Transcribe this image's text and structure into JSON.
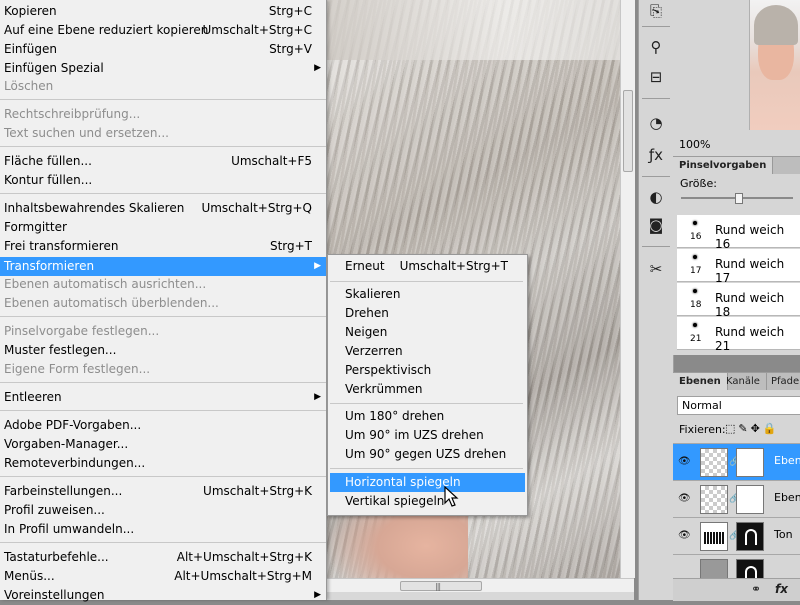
{
  "edit_menu": {
    "items": [
      {
        "label": "Kopieren",
        "shortcut": "Strg+C",
        "disabled": false
      },
      {
        "label": "Auf eine Ebene reduziert kopieren",
        "shortcut": "Umschalt+Strg+C",
        "disabled": false
      },
      {
        "label": "Einfügen",
        "shortcut": "Strg+V",
        "disabled": false
      },
      {
        "label": "Einfügen Spezial",
        "shortcut": "",
        "disabled": false,
        "submenu": true
      },
      {
        "label": "Löschen",
        "shortcut": "",
        "disabled": true
      },
      {
        "label": "Rechtschreibprüfung...",
        "shortcut": "",
        "disabled": true
      },
      {
        "label": "Text suchen und ersetzen...",
        "shortcut": "",
        "disabled": true
      },
      {
        "label": "Fläche füllen...",
        "shortcut": "Umschalt+F5",
        "disabled": false
      },
      {
        "label": "Kontur füllen...",
        "shortcut": "",
        "disabled": false
      },
      {
        "label": "Inhaltsbewahrendes Skalieren",
        "shortcut": "Umschalt+Strg+Q",
        "disabled": false
      },
      {
        "label": "Formgitter",
        "shortcut": "",
        "disabled": false
      },
      {
        "label": "Frei transformieren",
        "shortcut": "Strg+T",
        "disabled": false
      },
      {
        "label": "Transformieren",
        "shortcut": "",
        "disabled": false,
        "submenu": true,
        "highlighted": true
      },
      {
        "label": "Ebenen automatisch ausrichten...",
        "shortcut": "",
        "disabled": true
      },
      {
        "label": "Ebenen automatisch überblenden...",
        "shortcut": "",
        "disabled": true
      },
      {
        "label": "Pinselvorgabe festlegen...",
        "shortcut": "",
        "disabled": true
      },
      {
        "label": "Muster festlegen...",
        "shortcut": "",
        "disabled": false
      },
      {
        "label": "Eigene Form festlegen...",
        "shortcut": "",
        "disabled": true
      },
      {
        "label": "Entleeren",
        "shortcut": "",
        "disabled": false,
        "submenu": true
      },
      {
        "label": "Adobe PDF-Vorgaben...",
        "shortcut": "",
        "disabled": false
      },
      {
        "label": "Vorgaben-Manager...",
        "shortcut": "",
        "disabled": false
      },
      {
        "label": "Remoteverbindungen...",
        "shortcut": "",
        "disabled": false
      },
      {
        "label": "Farbeinstellungen...",
        "shortcut": "Umschalt+Strg+K",
        "disabled": false
      },
      {
        "label": "Profil zuweisen...",
        "shortcut": "",
        "disabled": false
      },
      {
        "label": "In Profil umwandeln...",
        "shortcut": "",
        "disabled": false
      },
      {
        "label": "Tastaturbefehle...",
        "shortcut": "Alt+Umschalt+Strg+K",
        "disabled": false
      },
      {
        "label": "Menüs...",
        "shortcut": "Alt+Umschalt+Strg+M",
        "disabled": false
      },
      {
        "label": "Voreinstellungen",
        "shortcut": "",
        "disabled": false,
        "submenu": true
      }
    ]
  },
  "transform_submenu": {
    "items": [
      {
        "label": "Erneut",
        "shortcut": "Umschalt+Strg+T"
      },
      {
        "label": "Skalieren",
        "shortcut": ""
      },
      {
        "label": "Drehen",
        "shortcut": ""
      },
      {
        "label": "Neigen",
        "shortcut": ""
      },
      {
        "label": "Verzerren",
        "shortcut": ""
      },
      {
        "label": "Perspektivisch",
        "shortcut": ""
      },
      {
        "label": "Verkrümmen",
        "shortcut": ""
      },
      {
        "label": "Um 180° drehen",
        "shortcut": ""
      },
      {
        "label": "Um 90° im UZS drehen",
        "shortcut": ""
      },
      {
        "label": "Um 90° gegen UZS drehen",
        "shortcut": ""
      },
      {
        "label": "Horizontal spiegeln",
        "shortcut": "",
        "highlighted": true
      },
      {
        "label": "Vertikal spiegeln",
        "shortcut": ""
      }
    ]
  },
  "submenu_arrow": "▶",
  "navigator": {
    "zoom": "100%"
  },
  "brush_panel": {
    "tab": "Pinselvorgaben",
    "size_label": "Größe:",
    "brushes": [
      {
        "num": "16",
        "name": "Rund weich 16"
      },
      {
        "num": "17",
        "name": "Rund weich 17"
      },
      {
        "num": "18",
        "name": "Rund weich 18"
      },
      {
        "num": "21",
        "name": "Rund weich 21"
      }
    ]
  },
  "layers_panel": {
    "tabs": [
      "Ebenen",
      "Kanäle",
      "Pfade"
    ],
    "blend_mode": "Normal",
    "lock_label": "Fixieren:",
    "layers": [
      {
        "name": "Ebene",
        "selected": true
      },
      {
        "name": "Ebene",
        "selected": false
      },
      {
        "name": "Ton",
        "selected": false
      }
    ],
    "footer_fx": "fx"
  },
  "colors": {
    "highlight": "#3399ff",
    "menu_bg": "#f0f0f0",
    "panel_bg": "#d6d6d6"
  }
}
